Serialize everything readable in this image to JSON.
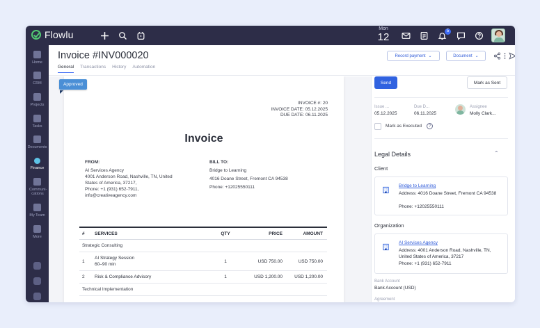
{
  "app": {
    "name": "Flowlu",
    "date_dow": "Mon",
    "date_day": "12",
    "notif_count": "5",
    "colors": {
      "sidebar": "#2d2d48",
      "accent": "#3062e0",
      "success": "#52c873"
    }
  },
  "sidebar": {
    "items": [
      {
        "label": "Home",
        "icon": "home-icon"
      },
      {
        "label": "CRM",
        "icon": "crm-icon"
      },
      {
        "label": "Projects",
        "icon": "projects-icon"
      },
      {
        "label": "Tasks",
        "icon": "tasks-icon"
      },
      {
        "label": "Documents",
        "icon": "documents-icon"
      },
      {
        "label": "Finance",
        "icon": "finance-icon",
        "active": true
      },
      {
        "label": "Communi- cations",
        "icon": "communications-icon"
      },
      {
        "label": "My Team",
        "icon": "team-icon"
      },
      {
        "label": "More",
        "icon": "more-icon"
      }
    ]
  },
  "header": {
    "title": "Invoice #INV000020",
    "tabs": [
      "General",
      "Transactions",
      "History",
      "Automation"
    ],
    "record_payment": "Record payment",
    "document": "Document"
  },
  "invoice": {
    "status": "Approved",
    "number_line": "INVOICE #: 20",
    "date_line": "INVOICE DATE: 05.12.2025",
    "due_line": "DUE DATE: 06.11.2025",
    "heading": "Invoice",
    "from_label": "FROM:",
    "from_lines": [
      "AI Services Agency",
      "4001 Anderson Road, Nashville, TN, United",
      "States of America, 37217,",
      "Phone: +1 (931) 652-7911,",
      "info@creativeagency.com"
    ],
    "bill_label": "BILL TO:",
    "bill_lines": [
      "Bridge to Learning",
      "4016 Doane Street, Fremont CA 94538",
      "Phone: +12025550111"
    ],
    "table_headers": {
      "num": "#",
      "services": "SERVICES",
      "qty": "QTY",
      "price": "PRICE",
      "amount": "AMOUNT"
    },
    "groups": [
      {
        "name": "Strategic Consulting",
        "rows": [
          {
            "num": "1",
            "service": "AI Strategy Session",
            "service2": "60–90 min",
            "qty": "1",
            "price": "USD 750.00",
            "amount": "USD 750.00"
          },
          {
            "num": "2",
            "service": "Risk & Compliance Advisory",
            "service2": "",
            "qty": "1",
            "price": "USD 1,200.00",
            "amount": "USD 1,200.00"
          }
        ]
      },
      {
        "name": "Technical Implementation",
        "rows": []
      }
    ]
  },
  "panel": {
    "send": "Send",
    "mark_sent": "Mark as Sent",
    "issue_label": "Issue ...",
    "issue_val": "05.12.2025",
    "due_label": "Due D...",
    "due_val": "06.11.2025",
    "assignee_label": "Assignee",
    "assignee_val": "Molly Clark...",
    "executed_label": "Mark as Executed",
    "help": "?",
    "legal_title": "Legal Details",
    "client_title": "Client",
    "client": {
      "name": "Bridge to Learning",
      "address": "Address: 4016 Doane Street, Fremont CA 94538",
      "phone": "Phone: +12025550111"
    },
    "org_title": "Organization",
    "org": {
      "name": "AI Services Agency",
      "address": "Address: 4001 Anderson Road, Nashville, TN, United States of America, 37217",
      "phone": "Phone: +1 (931) 652-7911"
    },
    "bank_label": "Bank Account",
    "bank_val": "Bank Account (USD)",
    "agreement_label": "Agreement"
  }
}
